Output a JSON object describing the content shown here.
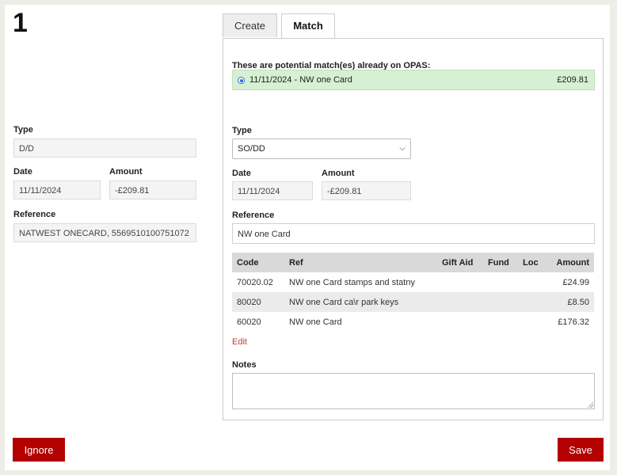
{
  "statement": {
    "number": "1",
    "type_label": "Type",
    "type_value": "D/D",
    "date_label": "Date",
    "date_value": "11/11/2024",
    "amount_label": "Amount",
    "amount_value": "-£209.81",
    "reference_label": "Reference",
    "reference_value": "NATWEST ONECARD, 5569510100751072"
  },
  "tabs": [
    {
      "label": "Create",
      "active": false
    },
    {
      "label": "Match",
      "active": true
    }
  ],
  "match": {
    "heading": "These are potential match(es) already on OPAS:",
    "options": [
      {
        "label": "11/11/2024 - NW one Card",
        "amount": "£209.81",
        "selected": true
      }
    ],
    "type_label": "Type",
    "type_value": "SO/DD",
    "date_label": "Date",
    "date_value": "11/11/2024",
    "amount_label": "Amount",
    "amount_value": "-£209.81",
    "reference_label": "Reference",
    "reference_value": "NW one Card",
    "table": {
      "columns": [
        "Code",
        "Ref",
        "Gift Aid",
        "Fund",
        "Loc",
        "Amount"
      ],
      "rows": [
        {
          "code": "70020.02",
          "ref": "NW one Card stamps and statny",
          "gift_aid": "",
          "fund": "",
          "loc": "",
          "amount": "£24.99"
        },
        {
          "code": "80020",
          "ref": "NW one Card ca\\r park keys",
          "gift_aid": "",
          "fund": "",
          "loc": "",
          "amount": "£8.50"
        },
        {
          "code": "60020",
          "ref": "NW one Card",
          "gift_aid": "",
          "fund": "",
          "loc": "",
          "amount": "£176.32"
        }
      ]
    },
    "edit_label": "Edit",
    "notes_label": "Notes",
    "notes_value": ""
  },
  "actions": {
    "ignore_label": "Ignore",
    "save_label": "Save"
  },
  "colors": {
    "accent": "#b30000",
    "match_bg": "#d5f0d2",
    "edit_link": "#c0392b"
  }
}
